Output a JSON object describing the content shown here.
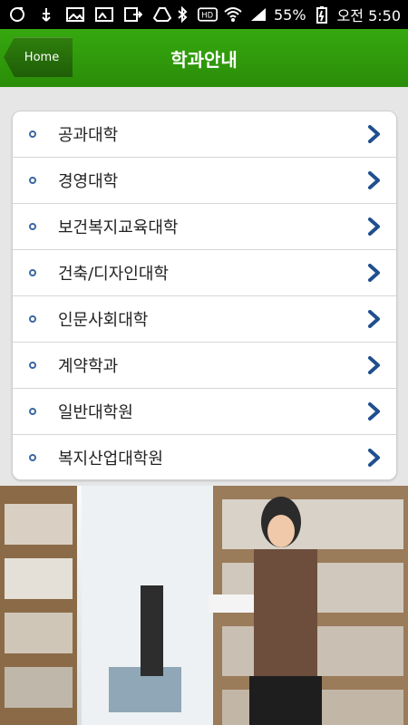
{
  "status_bar": {
    "battery": "55%",
    "time": "오전 5:50",
    "icons": [
      "g-icon",
      "usb-icon",
      "image-icon",
      "picture-icon",
      "export-icon",
      "drive-icon",
      "bluetooth-icon",
      "hd-icon",
      "wifi-icon",
      "signal-icon",
      "battery-icon"
    ]
  },
  "header": {
    "home_label": "Home",
    "title": "학과안내",
    "accent": "#2f9a0b"
  },
  "menu": {
    "items": [
      {
        "label": "공과대학"
      },
      {
        "label": "경영대학"
      },
      {
        "label": "보건복지교육대학"
      },
      {
        "label": "건축/디자인대학"
      },
      {
        "label": "인문사회대학"
      },
      {
        "label": "계약학과"
      },
      {
        "label": "일반대학원"
      },
      {
        "label": "복지산업대학원"
      }
    ]
  },
  "colors": {
    "chevron": "#1f4f8f",
    "bullet": "#3b67a3"
  }
}
